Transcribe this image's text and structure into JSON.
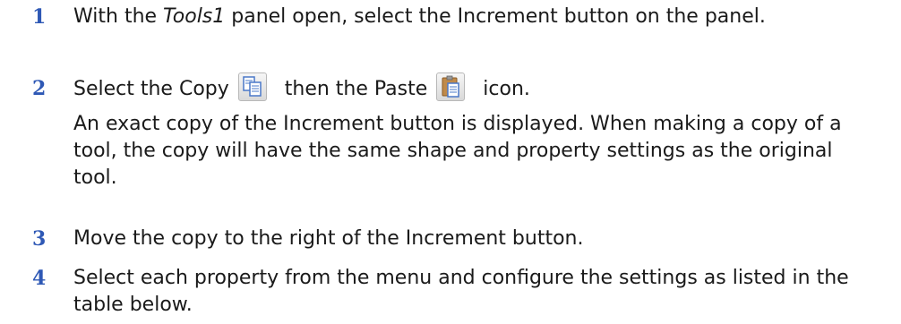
{
  "steps": [
    {
      "number": "1",
      "before": "With the ",
      "emph": "Tools1",
      "after": " panel open, select the Increment button on the panel."
    },
    {
      "number": "2",
      "part1": "Select the Copy",
      "copy_icon": "copy-icon",
      "part2": "then the Paste",
      "paste_icon": "paste-icon",
      "part3": "icon.",
      "note": "An exact copy of the Increment button is displayed. When making a copy of a tool, the copy will have the same shape and property settings as the original tool."
    },
    {
      "number": "3",
      "text": "Move the copy to the right of the Increment button."
    },
    {
      "number": "4",
      "text": "Select each property from the menu and configure the settings as listed in the table below."
    }
  ],
  "colors": {
    "step_number": "#2e58b5",
    "body_text": "#1a1a1a"
  }
}
